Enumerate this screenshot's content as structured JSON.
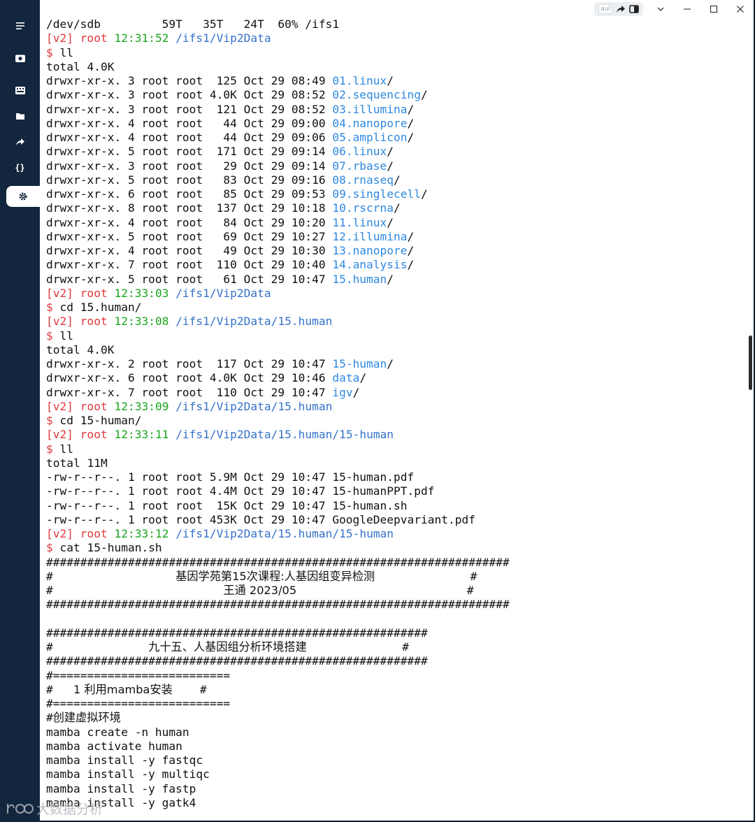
{
  "sidebar": {
    "items": [
      {
        "name": "menu-icon"
      },
      {
        "name": "camera-icon"
      },
      {
        "name": "keyboard-icon"
      },
      {
        "name": "folder-icon"
      },
      {
        "name": "share-icon"
      },
      {
        "name": "code-braces-icon"
      },
      {
        "name": "gear-icon",
        "active": true
      }
    ]
  },
  "titlebar": {
    "chip_text": "aul",
    "buttons": [
      "share-arrow-icon",
      "split-pane-icon",
      "chevron-down-icon",
      "minimize-icon",
      "maximize-icon",
      "close-icon"
    ]
  },
  "terminal": {
    "lines": [
      [
        {
          "t": "/dev/sdb         59T   35T   24T  60% /ifs1"
        }
      ],
      [
        {
          "t": "[v2]",
          "c": "red"
        },
        {
          "t": " "
        },
        {
          "t": "root",
          "c": "red"
        },
        {
          "t": " "
        },
        {
          "t": "12:31:52",
          "c": "green"
        },
        {
          "t": " "
        },
        {
          "t": "/ifs1/Vip2Data",
          "c": "blue"
        }
      ],
      [
        {
          "t": "$",
          "c": "red"
        },
        {
          "t": " ll"
        }
      ],
      [
        {
          "t": "total 4.0K"
        }
      ],
      [
        {
          "t": "drwxr-xr-x. 3 root root  125 Oct 29 08:49 "
        },
        {
          "t": "01.linux",
          "c": "lnk"
        },
        {
          "t": "/"
        }
      ],
      [
        {
          "t": "drwxr-xr-x. 3 root root 4.0K Oct 29 08:52 "
        },
        {
          "t": "02.sequencing",
          "c": "lnk"
        },
        {
          "t": "/"
        }
      ],
      [
        {
          "t": "drwxr-xr-x. 3 root root  121 Oct 29 08:52 "
        },
        {
          "t": "03.illumina",
          "c": "lnk"
        },
        {
          "t": "/"
        }
      ],
      [
        {
          "t": "drwxr-xr-x. 4 root root   44 Oct 29 09:00 "
        },
        {
          "t": "04.nanopore",
          "c": "lnk"
        },
        {
          "t": "/"
        }
      ],
      [
        {
          "t": "drwxr-xr-x. 4 root root   44 Oct 29 09:06 "
        },
        {
          "t": "05.amplicon",
          "c": "lnk"
        },
        {
          "t": "/"
        }
      ],
      [
        {
          "t": "drwxr-xr-x. 5 root root  171 Oct 29 09:14 "
        },
        {
          "t": "06.linux",
          "c": "lnk"
        },
        {
          "t": "/"
        }
      ],
      [
        {
          "t": "drwxr-xr-x. 3 root root   29 Oct 29 09:14 "
        },
        {
          "t": "07.rbase",
          "c": "lnk"
        },
        {
          "t": "/"
        }
      ],
      [
        {
          "t": "drwxr-xr-x. 5 root root   83 Oct 29 09:16 "
        },
        {
          "t": "08.rnaseq",
          "c": "lnk"
        },
        {
          "t": "/"
        }
      ],
      [
        {
          "t": "drwxr-xr-x. 6 root root   85 Oct 29 09:53 "
        },
        {
          "t": "09.singlecell",
          "c": "lnk"
        },
        {
          "t": "/"
        }
      ],
      [
        {
          "t": "drwxr-xr-x. 8 root root  137 Oct 29 10:18 "
        },
        {
          "t": "10.rscrna",
          "c": "lnk"
        },
        {
          "t": "/"
        }
      ],
      [
        {
          "t": "drwxr-xr-x. 4 root root   84 Oct 29 10:20 "
        },
        {
          "t": "11.linux",
          "c": "lnk"
        },
        {
          "t": "/"
        }
      ],
      [
        {
          "t": "drwxr-xr-x. 5 root root   69 Oct 29 10:27 "
        },
        {
          "t": "12.illumina",
          "c": "lnk"
        },
        {
          "t": "/"
        }
      ],
      [
        {
          "t": "drwxr-xr-x. 4 root root   49 Oct 29 10:30 "
        },
        {
          "t": "13.nanopore",
          "c": "lnk"
        },
        {
          "t": "/"
        }
      ],
      [
        {
          "t": "drwxr-xr-x. 7 root root  110 Oct 29 10:40 "
        },
        {
          "t": "14.analysis",
          "c": "lnk"
        },
        {
          "t": "/"
        }
      ],
      [
        {
          "t": "drwxr-xr-x. 5 root root   61 Oct 29 10:47 "
        },
        {
          "t": "15.human",
          "c": "lnk"
        },
        {
          "t": "/"
        }
      ],
      [
        {
          "t": "[v2]",
          "c": "red"
        },
        {
          "t": " "
        },
        {
          "t": "root",
          "c": "red"
        },
        {
          "t": " "
        },
        {
          "t": "12:33:03",
          "c": "green"
        },
        {
          "t": " "
        },
        {
          "t": "/ifs1/Vip2Data",
          "c": "blue"
        }
      ],
      [
        {
          "t": "$",
          "c": "red"
        },
        {
          "t": " cd 15.human/"
        }
      ],
      [
        {
          "t": "[v2]",
          "c": "red"
        },
        {
          "t": " "
        },
        {
          "t": "root",
          "c": "red"
        },
        {
          "t": " "
        },
        {
          "t": "12:33:08",
          "c": "green"
        },
        {
          "t": " "
        },
        {
          "t": "/ifs1/Vip2Data/15.human",
          "c": "blue"
        }
      ],
      [
        {
          "t": "$",
          "c": "red"
        },
        {
          "t": " ll"
        }
      ],
      [
        {
          "t": "total 4.0K"
        }
      ],
      [
        {
          "t": "drwxr-xr-x. 2 root root  117 Oct 29 10:47 "
        },
        {
          "t": "15-human",
          "c": "lnk"
        },
        {
          "t": "/"
        }
      ],
      [
        {
          "t": "drwxr-xr-x. 6 root root 4.0K Oct 29 10:46 "
        },
        {
          "t": "data",
          "c": "lnk"
        },
        {
          "t": "/"
        }
      ],
      [
        {
          "t": "drwxr-xr-x. 7 root root  110 Oct 29 10:47 "
        },
        {
          "t": "igv",
          "c": "lnk"
        },
        {
          "t": "/"
        }
      ],
      [
        {
          "t": "[v2]",
          "c": "red"
        },
        {
          "t": " "
        },
        {
          "t": "root",
          "c": "red"
        },
        {
          "t": " "
        },
        {
          "t": "12:33:09",
          "c": "green"
        },
        {
          "t": " "
        },
        {
          "t": "/ifs1/Vip2Data/15.human",
          "c": "blue"
        }
      ],
      [
        {
          "t": "$",
          "c": "red"
        },
        {
          "t": " cd 15-human/"
        }
      ],
      [
        {
          "t": "[v2]",
          "c": "red"
        },
        {
          "t": " "
        },
        {
          "t": "root",
          "c": "red"
        },
        {
          "t": " "
        },
        {
          "t": "12:33:11",
          "c": "green"
        },
        {
          "t": " "
        },
        {
          "t": "/ifs1/Vip2Data/15.human/15-human",
          "c": "blue"
        }
      ],
      [
        {
          "t": "$",
          "c": "red"
        },
        {
          "t": " ll"
        }
      ],
      [
        {
          "t": "total 11M"
        }
      ],
      [
        {
          "t": "-rw-r--r--. 1 root root 5.9M Oct 29 10:47 15-human.pdf"
        }
      ],
      [
        {
          "t": "-rw-r--r--. 1 root root 4.4M Oct 29 10:47 15-humanPPT.pdf"
        }
      ],
      [
        {
          "t": "-rw-r--r--. 1 root root  15K Oct 29 10:47 15-human.sh"
        }
      ],
      [
        {
          "t": "-rw-r--r--. 1 root root 453K Oct 29 10:47 GoogleDeepvariant.pdf"
        }
      ],
      [
        {
          "t": "[v2]",
          "c": "red"
        },
        {
          "t": " "
        },
        {
          "t": "root",
          "c": "red"
        },
        {
          "t": " "
        },
        {
          "t": "12:33:12",
          "c": "green"
        },
        {
          "t": " "
        },
        {
          "t": "/ifs1/Vip2Data/15.human/15-human",
          "c": "blue"
        }
      ],
      [
        {
          "t": "$",
          "c": "red"
        },
        {
          "t": " cat 15-human.sh"
        }
      ],
      [
        {
          "t": "####################################################################"
        }
      ],
      [
        {
          "t": "#                  "
        },
        {
          "t": "基因学苑第15次课程:人基因组变异检测",
          "c": "cjk"
        },
        {
          "t": "              #"
        }
      ],
      [
        {
          "t": "#                         "
        },
        {
          "t": "王通 2023/05",
          "c": "cjk"
        },
        {
          "t": "                         #"
        }
      ],
      [
        {
          "t": "####################################################################"
        }
      ],
      [
        {
          "t": ""
        }
      ],
      [
        {
          "t": "########################################################"
        }
      ],
      [
        {
          "t": "#              "
        },
        {
          "t": "九十五、人基因组分析环境搭建",
          "c": "cjk"
        },
        {
          "t": "              #"
        }
      ],
      [
        {
          "t": "########################################################"
        }
      ],
      [
        {
          "t": "#=========================="
        }
      ],
      [
        {
          "t": "#   "
        },
        {
          "t": "1 利用mamba安装",
          "c": "cjk"
        },
        {
          "t": "    #"
        }
      ],
      [
        {
          "t": "#=========================="
        }
      ],
      [
        {
          "t": "#"
        },
        {
          "t": "创建虚拟环境",
          "c": "cjk"
        }
      ],
      [
        {
          "t": "mamba create -n human"
        }
      ],
      [
        {
          "t": "mamba activate human"
        }
      ],
      [
        {
          "t": "mamba install -y fastqc"
        }
      ],
      [
        {
          "t": "mamba install -y multiqc"
        }
      ],
      [
        {
          "t": "mamba install -y fastp"
        }
      ],
      [
        {
          "t": "mamba install -y gatk4"
        }
      ]
    ]
  },
  "watermark": {
    "text": "大数据分析"
  },
  "colors": {
    "prompt_red": "#e03a3e",
    "time_green": "#19a51b",
    "path_blue": "#3572c9",
    "dir_blue": "#2e88e0",
    "sidebar_bg": "#12263d"
  }
}
